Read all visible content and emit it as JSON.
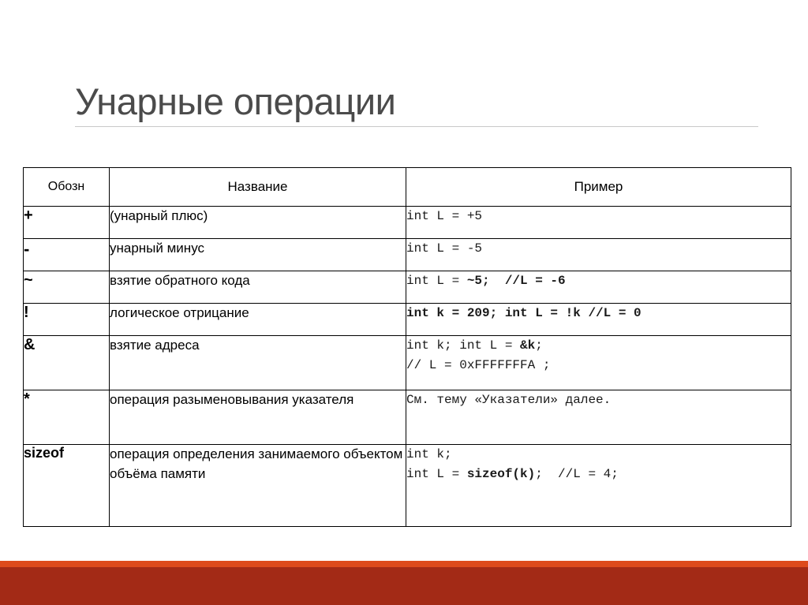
{
  "slide": {
    "title": "Унарные операции"
  },
  "table": {
    "headers": {
      "symbol": "Обозн",
      "name": "Название",
      "example": "Пример"
    },
    "rows": [
      {
        "symbol": "+",
        "name": "(унарный плюс)",
        "example_lines": [
          "int L = +5"
        ],
        "example_plain": "int L = +5"
      },
      {
        "symbol": "-",
        "name": "унарный минус",
        "example_lines": [
          "int L = -5"
        ],
        "example_plain": "int L = -5"
      },
      {
        "symbol": "~",
        "name": "взятие обратного кода",
        "example_lines": [
          "int L = ~5;  //L = -6"
        ],
        "example_prefix": "int L = ",
        "example_bold": "~5;  //L = -6"
      },
      {
        "symbol": "!",
        "name": "логическое отрицание",
        "example_lines": [
          "int k = 209; int L = !k //L = 0"
        ],
        "example_plain": "int k = 209; int L = !k //L = 0",
        "example_all_bold": true
      },
      {
        "symbol": "&",
        "name": "взятие адреса",
        "example_line1_prefix": "int k; int L = ",
        "example_line1_bold": "&k",
        "example_line1_suffix": ";",
        "example_line2": "// L = 0xFFFFFFFA ;"
      },
      {
        "symbol": "*",
        "name": "операция разыменовывания указателя",
        "example_lines": [
          "См. тему «Указатели» далее."
        ],
        "example_plain": "См. тему «Указатели» далее."
      },
      {
        "symbol": "sizeof",
        "name": "операция определения занимаемого объектом объёма памяти",
        "example_line1": "int k;",
        "example_line2_prefix": "int L = ",
        "example_line2_bold": "sizeof(k)",
        "example_line2_suffix": ";  //L = 4;"
      }
    ]
  },
  "footer": {
    "accent_color": "#dd4a1c",
    "band_color": "#a32a16"
  },
  "theme": {
    "title_color": "#4b4b4b",
    "rule_color": "#c9c9c9",
    "border_color": "#000000",
    "background": "#ffffff"
  }
}
